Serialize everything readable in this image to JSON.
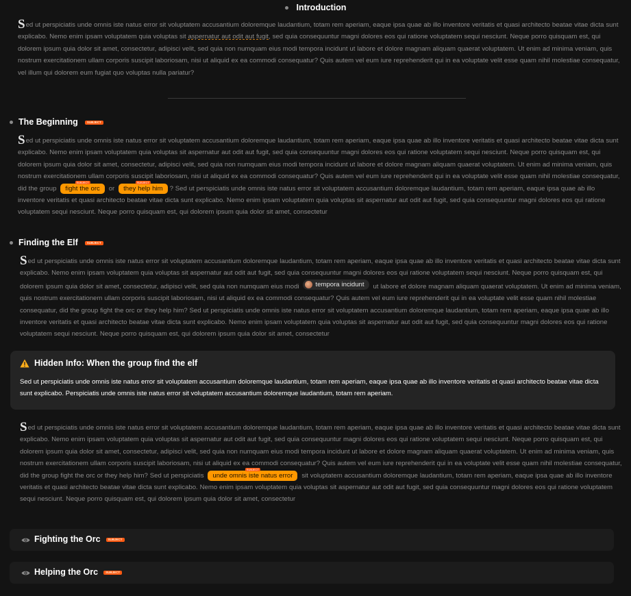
{
  "intro": {
    "title": "Introduction",
    "dropcap": "S",
    "text": "ed ut perspiciatis unde omnis iste natus error sit voluptatem accusantium doloremque laudantium, totam rem aperiam, eaque ipsa quae ab illo inventore veritatis et quasi architecto beatae vitae dicta sunt explicabo. Nemo enim ipsam voluptatem quia voluptas sit ",
    "underlined": "aspernatur aut odit aut fugit",
    "text_end": ", sed quia consequuntur magni dolores eos qui ratione voluptatem sequi nesciunt. Neque porro quisquam est, qui dolorem ipsum quia dolor sit amet, consectetur, adipisci velit, sed quia non numquam eius modi tempora incidunt ut labore et dolore magnam aliquam quaerat voluptatem. Ut enim ad minima veniam, quis nostrum exercitationem ullam corporis suscipit laboriosam, nisi ut aliquid ex ea commodi consequatur? Quis autem vel eum iure reprehenderit qui in ea voluptate velit esse quam nihil molestiae consequatur, vel illum qui dolorem eum fugiat quo voluptas nulla pariatur?"
  },
  "beginning": {
    "title": "The Beginning",
    "tag": "SUBJECT",
    "dropcap": "S",
    "text_a": "ed ut perspiciatis unde omnis iste natus error sit voluptatem accusantium doloremque laudantium, totam rem aperiam, eaque ipsa quae ab illo inventore veritatis et quasi architecto beatae vitae dicta sunt explicabo. Nemo enim ipsam voluptatem quia voluptas sit aspernatur aut odit aut fugit, sed quia consequuntur magni dolores eos qui ratione voluptatem sequi nesciunt. Neque porro quisquam est, qui dolorem ipsum quia dolor sit amet, consectetur, adipisci velit, sed quia non numquam eius modi tempora incidunt ut labore et dolore magnam aliquam quaerat voluptatem. Ut enim ad minima veniam, quis nostrum exercitationem ullam corporis suscipit laboriosam, nisi ut aliquid ex ea commodi consequatur? Quis autem vel eum iure reprehenderit qui in ea voluptate velit esse quam nihil molestiae consequatur, did the group",
    "choice_1": "fight the orc",
    "choice_1_tag": "SUBJECT",
    "or": "or",
    "choice_2": "they help him",
    "choice_2_tag": "SUBJECT",
    "text_b": "? Sed ut perspiciatis unde omnis iste natus error sit voluptatem accusantium doloremque laudantium, totam rem aperiam, eaque ipsa quae ab illo inventore veritatis et quasi architecto beatae vitae dicta sunt explicabo. Nemo enim ipsam voluptatem quia voluptas sit aspernatur aut odit aut fugit, sed quia consequuntur magni dolores eos qui ratione voluptatem sequi nesciunt. Neque porro quisquam est, qui dolorem ipsum quia dolor sit amet, consectetur"
  },
  "elf": {
    "title": "Finding the Elf",
    "tag": "SUBJECT",
    "dropcap": "S",
    "text_a": "ed ut perspiciatis unde omnis iste natus error sit voluptatem accusantium doloremque laudantium, totam rem aperiam, eaque ipsa quae ab illo inventore veritatis et quasi architecto beatae vitae dicta sunt explicabo. Nemo enim ipsam voluptatem quia voluptas sit aspernatur aut odit aut fugit, sed quia consequuntur magni dolores eos qui ratione voluptatem sequi nesciunt. Neque porro quisquam est, qui dolorem ipsum quia dolor sit amet, consectetur, adipisci velit, sed quia non numquam eius modi",
    "link_label": "tempora incidunt",
    "text_b": "ut labore et dolore magnam aliquam quaerat voluptatem. Ut enim ad minima veniam, quis nostrum exercitationem ullam corporis suscipit laboriosam, nisi ut aliquid ex ea commodi consequatur? Quis autem vel eum iure reprehenderit qui in ea voluptate velit esse quam nihil molestiae consequatur, did the group fight the orc or they help him? Sed ut perspiciatis unde omnis iste natus error sit voluptatem accusantium doloremque laudantium, totam rem aperiam, eaque ipsa quae ab illo inventore veritatis et quasi architecto beatae vitae dicta sunt explicabo. Nemo enim ipsam voluptatem quia voluptas sit aspernatur aut odit aut fugit, sed quia consequuntur magni dolores eos qui ratione voluptatem sequi nesciunt. Neque porro quisquam est, qui dolorem ipsum quia dolor sit amet, consectetur"
  },
  "hidden_info": {
    "title": "Hidden Info: When the group find the elf",
    "text": "Sed ut perspiciatis unde omnis iste natus error sit voluptatem accusantium doloremque laudantium, totam rem aperiam, eaque ipsa quae ab illo inventore veritatis et quasi architecto beatae vitae dicta sunt explicabo. Perspiciatis unde omnis iste natus error sit voluptatem accusantium doloremque laudantium, totam rem aperiam."
  },
  "after_card": {
    "dropcap": "S",
    "text_a": "ed ut perspiciatis unde omnis iste natus error sit voluptatem accusantium doloremque laudantium, totam rem aperiam, eaque ipsa quae ab illo inventore veritatis et quasi architecto beatae vitae dicta sunt explicabo. Nemo enim ipsam voluptatem quia voluptas sit aspernatur aut odit aut fugit, sed quia consequuntur magni dolores eos qui ratione voluptatem sequi nesciunt. Neque porro quisquam est, qui dolorem ipsum quia dolor sit amet, consectetur, adipisci velit, sed quia non numquam eius modi tempora incidunt ut labore et dolore magnam aliquam quaerat voluptatem. Ut enim ad minima veniam, quis nostrum exercitationem ullam corporis suscipit laboriosam, nisi ut aliquid ex ea commodi consequatur? Quis autem vel eum iure reprehenderit qui in ea voluptate velit esse quam nihil molestiae consequatur, did the group fight the orc or they help him? Sed ut perspiciatis",
    "chip": "unde omnis iste natus error",
    "chip_tag": "SUBJECT",
    "text_b": "sit voluptatem accusantium doloremque laudantium, totam rem aperiam, eaque ipsa quae ab illo inventore veritatis et quasi architecto beatae vitae dicta sunt explicabo. Nemo enim ipsam voluptatem quia voluptas sit aspernatur aut odit aut fugit, sed quia consequuntur magni dolores eos qui ratione voluptatem sequi nesciunt. Neque porro quisquam est, qui dolorem ipsum quia dolor sit amet, consectetur"
  },
  "panels": [
    {
      "title": "Fighting the Orc",
      "tag": "SUBJECT",
      "icon": "eye-icon"
    },
    {
      "title": "Helping the Orc",
      "tag": "SUBJECT",
      "icon": "eye-icon"
    }
  ],
  "colors": {
    "background": "#131313",
    "chip": "#ff9800",
    "tag": "#ff5a12",
    "card": "#242424"
  }
}
